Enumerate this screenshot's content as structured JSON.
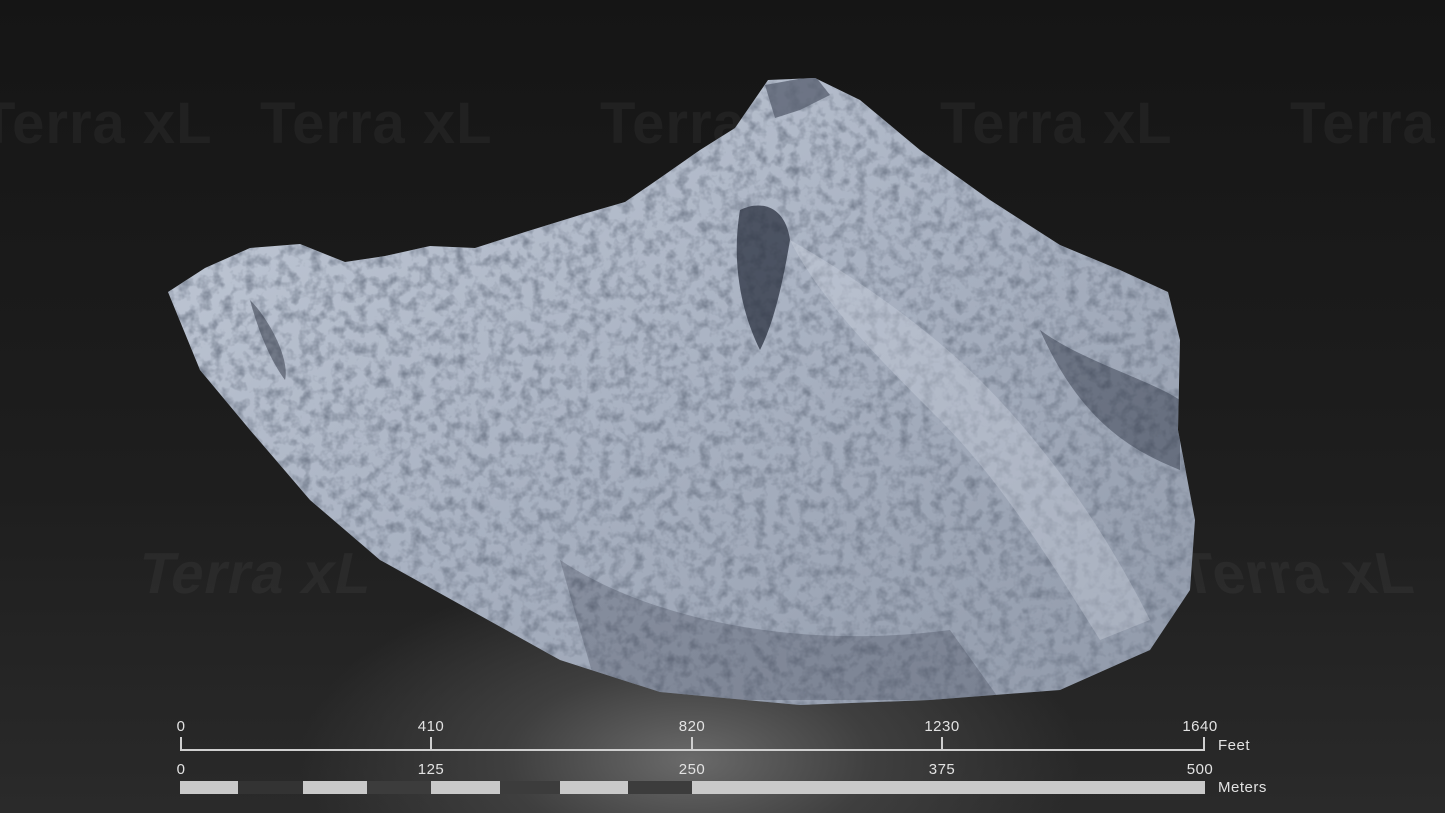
{
  "watermark": {
    "brand": "Terra xL"
  },
  "scale_bar": {
    "feet": {
      "ticks": [
        "0",
        "410",
        "820",
        "1230",
        "1640"
      ],
      "unit": "Feet"
    },
    "meters": {
      "ticks": [
        "0",
        "125",
        "250",
        "375",
        "500"
      ],
      "unit": "Meters",
      "segment_colors": [
        "#c9c9c9",
        "#333333",
        "#c9c9c9",
        "#3c3c3c",
        "#c9c9c9",
        "#3c3c3c",
        "#c9c9c9",
        "#3c3c3c",
        "#c9c9c9"
      ]
    }
  },
  "colors": {
    "terrain_light": "#b9c1cf",
    "terrain_mid": "#8d96a6",
    "terrain_shadow": "#2b3140",
    "scale_text": "#e2e2e2"
  }
}
